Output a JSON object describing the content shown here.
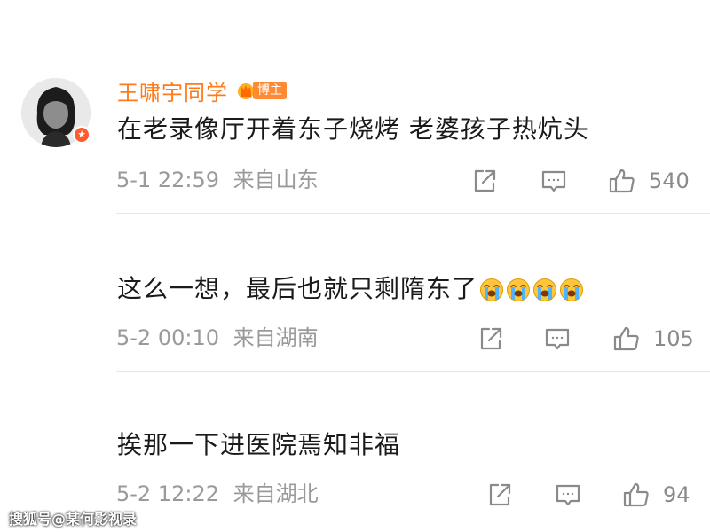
{
  "comments": [
    {
      "username": "王啸宇同学",
      "badge_label": "博主",
      "text": "在老录像厅开着东子烧烤 老婆孩子热炕头",
      "time": "5-1 22:59",
      "location": "来自山东",
      "likes": "540"
    },
    {
      "text": "这么一想，最后也就只剩隋东了",
      "emoji_count": 4,
      "emoji_icon": "loudly-crying-face",
      "time": "5-2 00:10",
      "location": "来自湖南",
      "likes": "105"
    },
    {
      "text": "挨那一下进医院焉知非福",
      "time": "5-2 12:22",
      "location": "来自湖北",
      "likes": "94"
    }
  ],
  "watermark": "搜狐号@某何影视录",
  "colors": {
    "username": "#ff7a1a",
    "badge_bg": "#ff8a33",
    "meta_text": "#9a9a9a",
    "icon_stroke": "#8a8a8a"
  }
}
